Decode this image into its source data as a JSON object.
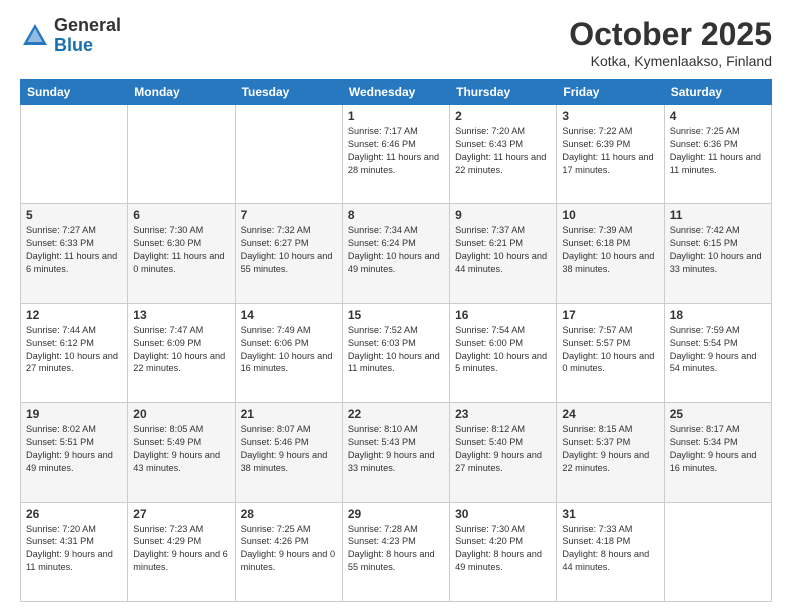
{
  "header": {
    "logo_general": "General",
    "logo_blue": "Blue",
    "month_title": "October 2025",
    "location": "Kotka, Kymenlaakso, Finland"
  },
  "weekdays": [
    "Sunday",
    "Monday",
    "Tuesday",
    "Wednesday",
    "Thursday",
    "Friday",
    "Saturday"
  ],
  "weeks": [
    [
      {
        "day": "",
        "sunrise": "",
        "sunset": "",
        "daylight": ""
      },
      {
        "day": "",
        "sunrise": "",
        "sunset": "",
        "daylight": ""
      },
      {
        "day": "",
        "sunrise": "",
        "sunset": "",
        "daylight": ""
      },
      {
        "day": "1",
        "sunrise": "Sunrise: 7:17 AM",
        "sunset": "Sunset: 6:46 PM",
        "daylight": "Daylight: 11 hours and 28 minutes."
      },
      {
        "day": "2",
        "sunrise": "Sunrise: 7:20 AM",
        "sunset": "Sunset: 6:43 PM",
        "daylight": "Daylight: 11 hours and 22 minutes."
      },
      {
        "day": "3",
        "sunrise": "Sunrise: 7:22 AM",
        "sunset": "Sunset: 6:39 PM",
        "daylight": "Daylight: 11 hours and 17 minutes."
      },
      {
        "day": "4",
        "sunrise": "Sunrise: 7:25 AM",
        "sunset": "Sunset: 6:36 PM",
        "daylight": "Daylight: 11 hours and 11 minutes."
      }
    ],
    [
      {
        "day": "5",
        "sunrise": "Sunrise: 7:27 AM",
        "sunset": "Sunset: 6:33 PM",
        "daylight": "Daylight: 11 hours and 6 minutes."
      },
      {
        "day": "6",
        "sunrise": "Sunrise: 7:30 AM",
        "sunset": "Sunset: 6:30 PM",
        "daylight": "Daylight: 11 hours and 0 minutes."
      },
      {
        "day": "7",
        "sunrise": "Sunrise: 7:32 AM",
        "sunset": "Sunset: 6:27 PM",
        "daylight": "Daylight: 10 hours and 55 minutes."
      },
      {
        "day": "8",
        "sunrise": "Sunrise: 7:34 AM",
        "sunset": "Sunset: 6:24 PM",
        "daylight": "Daylight: 10 hours and 49 minutes."
      },
      {
        "day": "9",
        "sunrise": "Sunrise: 7:37 AM",
        "sunset": "Sunset: 6:21 PM",
        "daylight": "Daylight: 10 hours and 44 minutes."
      },
      {
        "day": "10",
        "sunrise": "Sunrise: 7:39 AM",
        "sunset": "Sunset: 6:18 PM",
        "daylight": "Daylight: 10 hours and 38 minutes."
      },
      {
        "day": "11",
        "sunrise": "Sunrise: 7:42 AM",
        "sunset": "Sunset: 6:15 PM",
        "daylight": "Daylight: 10 hours and 33 minutes."
      }
    ],
    [
      {
        "day": "12",
        "sunrise": "Sunrise: 7:44 AM",
        "sunset": "Sunset: 6:12 PM",
        "daylight": "Daylight: 10 hours and 27 minutes."
      },
      {
        "day": "13",
        "sunrise": "Sunrise: 7:47 AM",
        "sunset": "Sunset: 6:09 PM",
        "daylight": "Daylight: 10 hours and 22 minutes."
      },
      {
        "day": "14",
        "sunrise": "Sunrise: 7:49 AM",
        "sunset": "Sunset: 6:06 PM",
        "daylight": "Daylight: 10 hours and 16 minutes."
      },
      {
        "day": "15",
        "sunrise": "Sunrise: 7:52 AM",
        "sunset": "Sunset: 6:03 PM",
        "daylight": "Daylight: 10 hours and 11 minutes."
      },
      {
        "day": "16",
        "sunrise": "Sunrise: 7:54 AM",
        "sunset": "Sunset: 6:00 PM",
        "daylight": "Daylight: 10 hours and 5 minutes."
      },
      {
        "day": "17",
        "sunrise": "Sunrise: 7:57 AM",
        "sunset": "Sunset: 5:57 PM",
        "daylight": "Daylight: 10 hours and 0 minutes."
      },
      {
        "day": "18",
        "sunrise": "Sunrise: 7:59 AM",
        "sunset": "Sunset: 5:54 PM",
        "daylight": "Daylight: 9 hours and 54 minutes."
      }
    ],
    [
      {
        "day": "19",
        "sunrise": "Sunrise: 8:02 AM",
        "sunset": "Sunset: 5:51 PM",
        "daylight": "Daylight: 9 hours and 49 minutes."
      },
      {
        "day": "20",
        "sunrise": "Sunrise: 8:05 AM",
        "sunset": "Sunset: 5:49 PM",
        "daylight": "Daylight: 9 hours and 43 minutes."
      },
      {
        "day": "21",
        "sunrise": "Sunrise: 8:07 AM",
        "sunset": "Sunset: 5:46 PM",
        "daylight": "Daylight: 9 hours and 38 minutes."
      },
      {
        "day": "22",
        "sunrise": "Sunrise: 8:10 AM",
        "sunset": "Sunset: 5:43 PM",
        "daylight": "Daylight: 9 hours and 33 minutes."
      },
      {
        "day": "23",
        "sunrise": "Sunrise: 8:12 AM",
        "sunset": "Sunset: 5:40 PM",
        "daylight": "Daylight: 9 hours and 27 minutes."
      },
      {
        "day": "24",
        "sunrise": "Sunrise: 8:15 AM",
        "sunset": "Sunset: 5:37 PM",
        "daylight": "Daylight: 9 hours and 22 minutes."
      },
      {
        "day": "25",
        "sunrise": "Sunrise: 8:17 AM",
        "sunset": "Sunset: 5:34 PM",
        "daylight": "Daylight: 9 hours and 16 minutes."
      }
    ],
    [
      {
        "day": "26",
        "sunrise": "Sunrise: 7:20 AM",
        "sunset": "Sunset: 4:31 PM",
        "daylight": "Daylight: 9 hours and 11 minutes."
      },
      {
        "day": "27",
        "sunrise": "Sunrise: 7:23 AM",
        "sunset": "Sunset: 4:29 PM",
        "daylight": "Daylight: 9 hours and 6 minutes."
      },
      {
        "day": "28",
        "sunrise": "Sunrise: 7:25 AM",
        "sunset": "Sunset: 4:26 PM",
        "daylight": "Daylight: 9 hours and 0 minutes."
      },
      {
        "day": "29",
        "sunrise": "Sunrise: 7:28 AM",
        "sunset": "Sunset: 4:23 PM",
        "daylight": "Daylight: 8 hours and 55 minutes."
      },
      {
        "day": "30",
        "sunrise": "Sunrise: 7:30 AM",
        "sunset": "Sunset: 4:20 PM",
        "daylight": "Daylight: 8 hours and 49 minutes."
      },
      {
        "day": "31",
        "sunrise": "Sunrise: 7:33 AM",
        "sunset": "Sunset: 4:18 PM",
        "daylight": "Daylight: 8 hours and 44 minutes."
      },
      {
        "day": "",
        "sunrise": "",
        "sunset": "",
        "daylight": ""
      }
    ]
  ]
}
